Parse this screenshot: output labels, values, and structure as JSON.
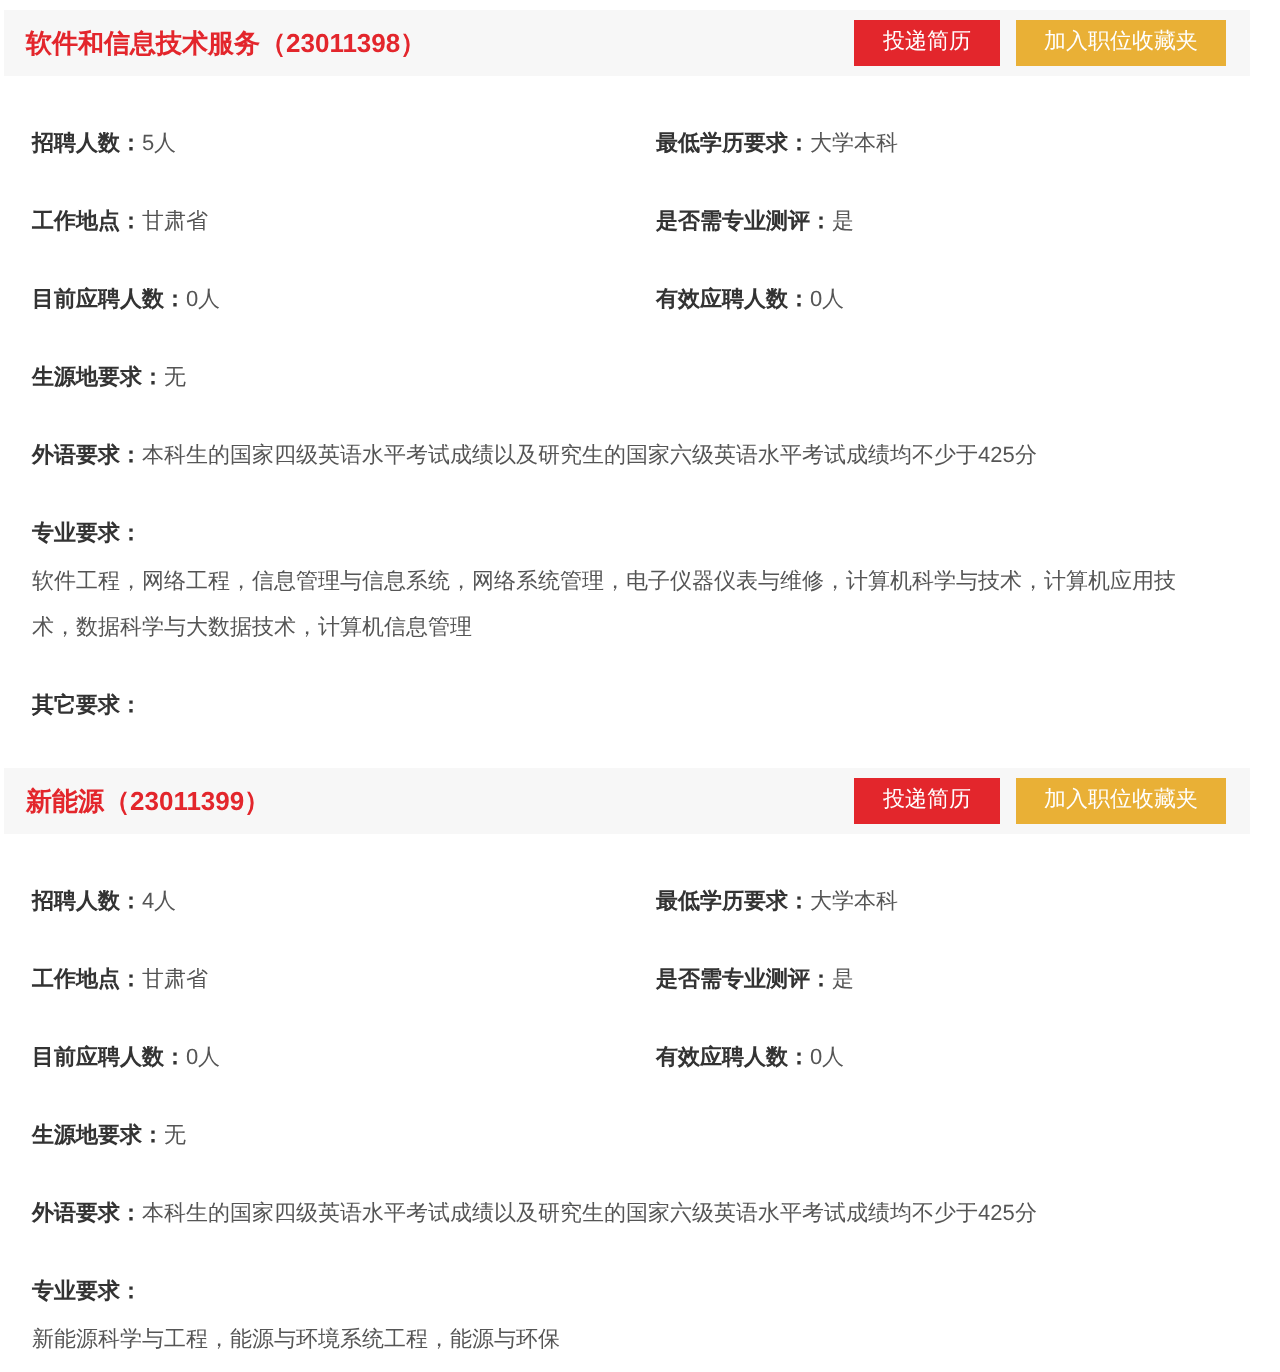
{
  "positions": [
    {
      "title": "软件和信息技术服务（23011398）",
      "buttons": [
        "投递简历",
        "加入职位收藏夹"
      ],
      "rows": [
        {
          "kind": "pair",
          "items": [
            {
              "label": "招聘人数：",
              "value": "5人"
            },
            {
              "label": "最低学历要求：",
              "value": "大学本科"
            }
          ]
        },
        {
          "kind": "pair",
          "items": [
            {
              "label": "工作地点：",
              "value": "甘肃省"
            },
            {
              "label": "是否需专业测评：",
              "value": "是"
            }
          ]
        },
        {
          "kind": "pair",
          "items": [
            {
              "label": "目前应聘人数：",
              "value": "0人"
            },
            {
              "label": "有效应聘人数：",
              "value": "0人"
            }
          ]
        },
        {
          "kind": "pair",
          "items": [
            {
              "label": "生源地要求：",
              "value": "无"
            }
          ]
        },
        {
          "kind": "pair",
          "items": [
            {
              "label": "外语要求：",
              "value": "本科生的国家四级英语水平考试成绩以及研究生的国家六级英语水平考试成绩均不少于425分"
            }
          ]
        },
        {
          "kind": "block",
          "label": "专业要求：",
          "value": "软件工程，网络工程，信息管理与信息系统，网络系统管理，电子仪器仪表与维修，计算机科学与技术，计算机应用技术，数据科学与大数据技术，计算机信息管理"
        },
        {
          "kind": "pair",
          "items": [
            {
              "label": "其它要求："
            }
          ]
        }
      ]
    },
    {
      "title": "新能源（23011399）",
      "buttons": [
        "投递简历",
        "加入职位收藏夹"
      ],
      "rows": [
        {
          "kind": "pair",
          "items": [
            {
              "label": "招聘人数：",
              "value": "4人"
            },
            {
              "label": "最低学历要求：",
              "value": "大学本科"
            }
          ]
        },
        {
          "kind": "pair",
          "items": [
            {
              "label": "工作地点：",
              "value": "甘肃省"
            },
            {
              "label": "是否需专业测评：",
              "value": "是"
            }
          ]
        },
        {
          "kind": "pair",
          "items": [
            {
              "label": "目前应聘人数：",
              "value": "0人"
            },
            {
              "label": "有效应聘人数：",
              "value": "0人"
            }
          ]
        },
        {
          "kind": "pair",
          "items": [
            {
              "label": "生源地要求：",
              "value": "无"
            }
          ]
        },
        {
          "kind": "pair",
          "items": [
            {
              "label": "外语要求：",
              "value": "本科生的国家四级英语水平考试成绩以及研究生的国家六级英语水平考试成绩均不少于425分"
            }
          ]
        },
        {
          "kind": "block",
          "label": "专业要求：",
          "value": "新能源科学与工程，能源与环境系统工程，能源与环保"
        }
      ]
    }
  ]
}
